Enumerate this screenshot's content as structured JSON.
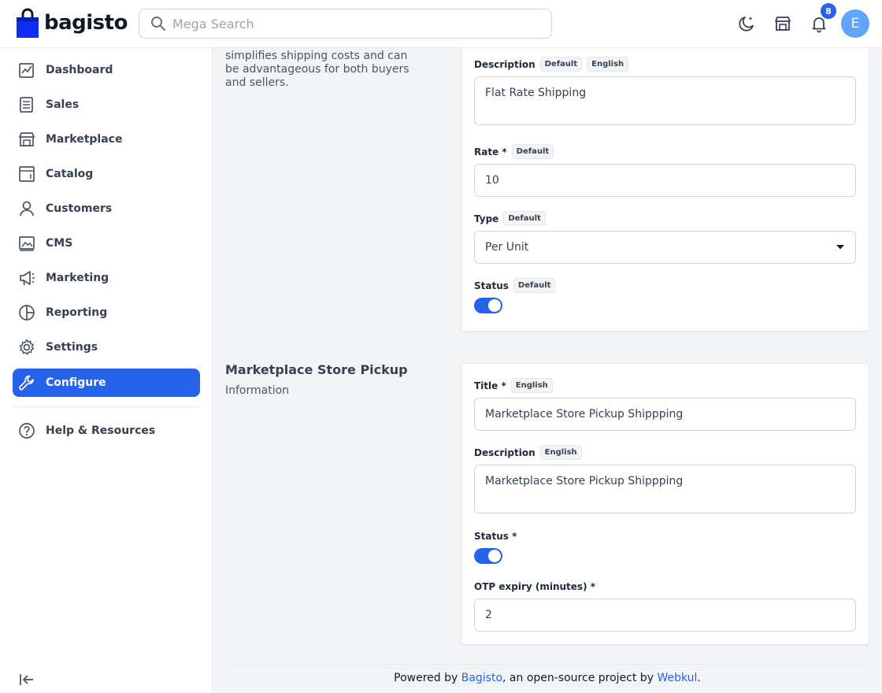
{
  "header": {
    "logo_text": "bagisto",
    "search_placeholder": "Mega Search",
    "notification_count": "8",
    "avatar_initial": "E"
  },
  "sidebar": {
    "items": [
      {
        "label": "Dashboard",
        "icon": "dashboard-icon"
      },
      {
        "label": "Sales",
        "icon": "sales-icon"
      },
      {
        "label": "Marketplace",
        "icon": "store-icon"
      },
      {
        "label": "Catalog",
        "icon": "catalog-icon"
      },
      {
        "label": "Customers",
        "icon": "user-icon"
      },
      {
        "label": "CMS",
        "icon": "cms-icon"
      },
      {
        "label": "Marketing",
        "icon": "megaphone-icon"
      },
      {
        "label": "Reporting",
        "icon": "pie-chart-icon"
      },
      {
        "label": "Settings",
        "icon": "gear-icon"
      },
      {
        "label": "Configure",
        "icon": "wrench-icon",
        "active": true
      }
    ],
    "help_label": "Help & Resources"
  },
  "flat_rate": {
    "description_text": "simplifies shipping costs and can be advantageous for both buyers and sellers.",
    "description_label": "Description",
    "description_tags": [
      "Default",
      "English"
    ],
    "description_value": "Flat Rate Shipping",
    "rate_label": "Rate *",
    "rate_tag": "Default",
    "rate_value": "10",
    "type_label": "Type",
    "type_tag": "Default",
    "type_value": "Per Unit",
    "status_label": "Status",
    "status_tag": "Default",
    "status_on": true
  },
  "store_pickup": {
    "section_title": "Marketplace Store Pickup",
    "section_subtitle": "Information",
    "title_label": "Title *",
    "title_tag": "English",
    "title_value": "Marketplace Store Pickup Shippping",
    "description_label": "Description",
    "description_tag": "English",
    "description_value": "Marketplace Store Pickup Shippping",
    "status_label": "Status *",
    "status_on": true,
    "otp_label": "OTP expiry (minutes) *",
    "otp_value": "2"
  },
  "footer": {
    "prefix": "Powered by ",
    "link1": "Bagisto",
    "middle": ", an open-source project by ",
    "link2": "Webkul",
    "suffix": "."
  },
  "colors": {
    "accent": "#2563eb",
    "avatar": "#60a5fa"
  }
}
